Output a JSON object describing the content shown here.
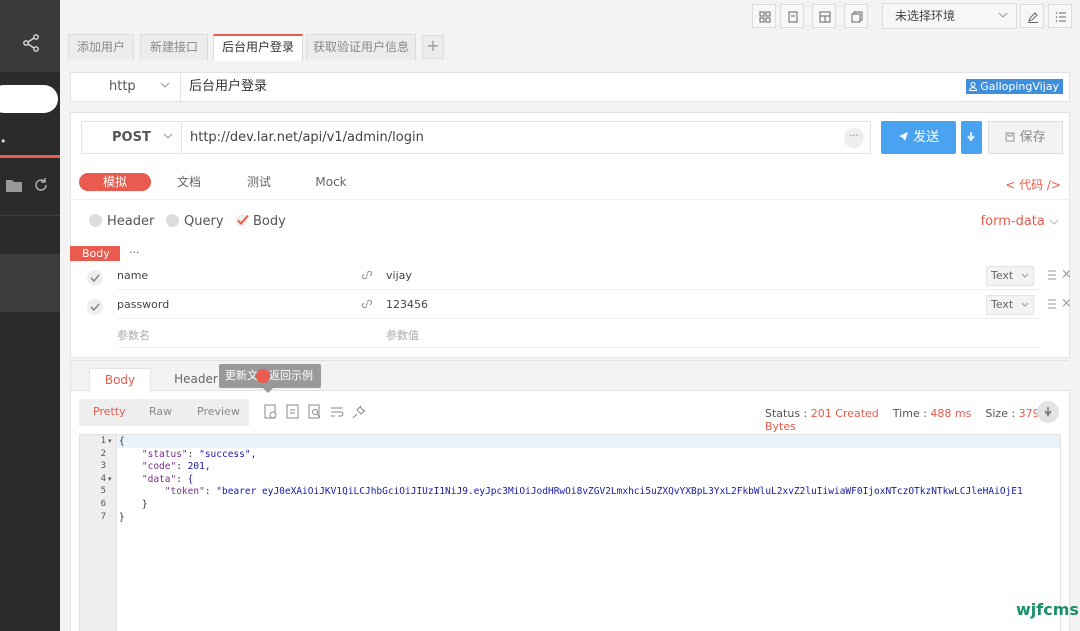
{
  "toolbar": {
    "environment": "未选择环境"
  },
  "tabs": [
    {
      "label": "添加用户"
    },
    {
      "label": "新建接口"
    },
    {
      "label": "后台用户登录"
    },
    {
      "label": "获取验证用户信息"
    }
  ],
  "tab_add_label": "+",
  "api": {
    "protocol": "http",
    "name": "后台用户登录",
    "user": "GallopingVijay"
  },
  "request": {
    "method": "POST",
    "url": "http://dev.lar.net/api/v1/admin/login",
    "more": "···",
    "send_label": "发送",
    "save_label": "保存"
  },
  "subtabs": [
    "模拟",
    "文档",
    "测试",
    "Mock"
  ],
  "code_link": "< 代码 />",
  "body_types": [
    "Header",
    "Query",
    "Body"
  ],
  "content_type": "form-data",
  "body_tag": "Body",
  "body_more": "···",
  "params": [
    {
      "name": "name",
      "value": "vijay",
      "type": "Text"
    },
    {
      "name": "password",
      "value": "123456",
      "type": "Text"
    }
  ],
  "param_placeholder": {
    "name": "参数名",
    "value": "参数值"
  },
  "response": {
    "tabs": [
      "Body",
      "Header"
    ],
    "tooltip": "更新文档返回示例",
    "formats": [
      "Pretty",
      "Raw",
      "Preview"
    ],
    "status_label": "Status :",
    "status_value": "201 Created",
    "time_label": "Time :",
    "time_value": "488 ms",
    "size_label": "Size :",
    "size_value": "379 Bytes",
    "lines": [
      "{",
      "    \"status\": \"success\",",
      "    \"code\": 201,",
      "    \"data\": {",
      "        \"token\": \"bearer eyJ0eXAiOiJKV1QiLCJhbGciOiJIUzI1NiJ9.eyJpc3MiOiJodHRwOi8vZGV2Lmxhci5uZXQvYXBpL3YxL2FkbWluL2xvZ2luIiwiaWF0IjoxNTczOTkzNTkwLCJleHAiOjE1",
      "    }",
      "}"
    ]
  },
  "watermark": "wjfcms",
  "colors": {
    "accent": "#e85b4e",
    "primary": "#4aa3f0",
    "user_badge": "#3d8fdc"
  }
}
